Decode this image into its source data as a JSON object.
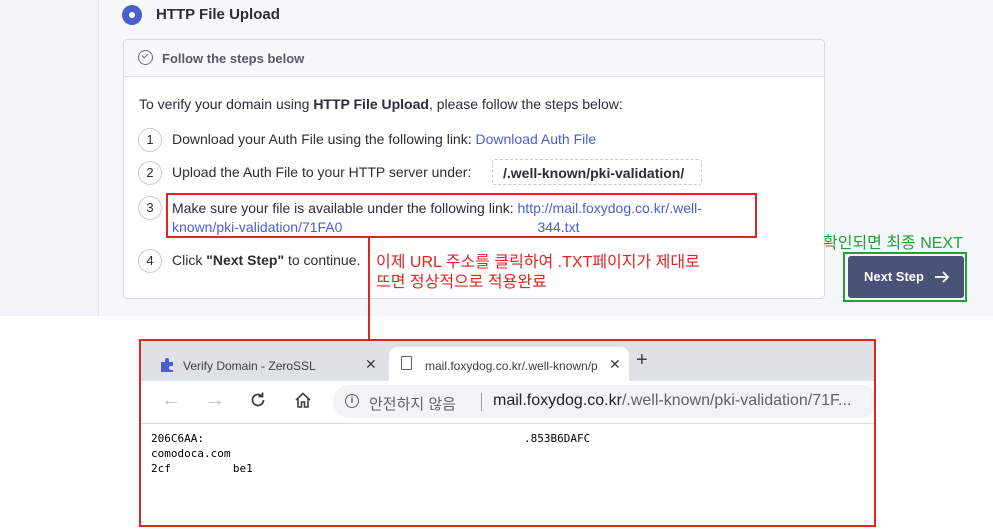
{
  "method": {
    "title": "HTTP File Upload"
  },
  "card": {
    "header": "Follow the steps below",
    "intro_prefix": "To verify your domain using ",
    "intro_bold": "HTTP File Upload",
    "intro_suffix": ", please follow the steps below:",
    "steps": [
      {
        "num": "1",
        "text": "Download your Auth File using the following link: ",
        "link": "Download Auth File"
      },
      {
        "num": "2",
        "text": "Upload the Auth File to your HTTP server under:",
        "path": "/.well-known/pki-validation/"
      },
      {
        "num": "3",
        "text": "Make sure your file is available under the following link: ",
        "link_line1": "http://mail.foxydog.co.kr/.well-",
        "link_line2a": "known/pki-validation/71FA0",
        "link_line2b": "344.txt"
      },
      {
        "num": "4",
        "text_prefix": "Click ",
        "text_bold": "\"Next Step\"",
        "text_suffix": " to continue."
      }
    ]
  },
  "annotations": {
    "korean_line1": "이제 URL 주소를 클릭하여 .TXT페이지가 제대로",
    "korean_line2": "뜨면 정상적으로 적용완료",
    "green_note": "확인되면 최종 NEXT"
  },
  "next_button": {
    "label": "Next Step"
  },
  "browser": {
    "tab1_title": "Verify Domain - ZeroSSL",
    "tab2_title": "mail.foxydog.co.kr/.well-known/p",
    "close_glyph": "✕",
    "new_tab_glyph": "+",
    "back_glyph": "←",
    "forward_glyph": "→",
    "info_glyph": "i",
    "security_text": "안전하지 않음",
    "url_host": "mail.foxydog.co.kr",
    "url_rest": "/.well-known/pki-validation/71F...",
    "content_lines": [
      {
        "a": "206C6AA:",
        "b": ".853B6DAFC"
      },
      {
        "a": "comodoca.com",
        "b": ""
      },
      {
        "a": "2cf",
        "b": "be1"
      }
    ]
  }
}
